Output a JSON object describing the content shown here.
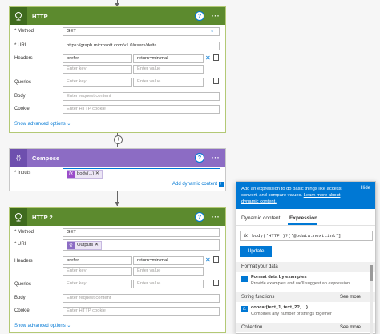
{
  "http": {
    "title": "HTTP",
    "method_label": "* Method",
    "method_value": "GET",
    "uri_label": "* URI",
    "uri_value": "https://graph.microsoft.com/v1.0/users/delta",
    "headers_label": "Headers",
    "header_key": "prefer",
    "header_value": "return=minimal",
    "enter_key": "Enter key",
    "enter_value": "Enter value",
    "queries_label": "Queries",
    "body_label": "Body",
    "body_placeholder": "Enter request content",
    "cookie_label": "Cookie",
    "cookie_placeholder": "Enter HTTP cookie",
    "advanced": "Show advanced options"
  },
  "compose": {
    "title": "Compose",
    "inputs_label": "* Inputs",
    "chip_label": "body(...)",
    "add_dynamic": "Add dynamic content"
  },
  "http2": {
    "title": "HTTP 2",
    "method_label": "* Method",
    "method_value": "GET",
    "uri_label": "* URI",
    "uri_chip": "Outputs",
    "headers_label": "Headers",
    "header_key": "prefer",
    "header_value": "return=minimal",
    "enter_key": "Enter key",
    "enter_value": "Enter value",
    "queries_label": "Queries",
    "body_label": "Body",
    "body_placeholder": "Enter request content",
    "cookie_label": "Cookie",
    "cookie_placeholder": "Enter HTTP cookie",
    "advanced": "Show advanced options"
  },
  "panel": {
    "banner_text": "Add an expression to do basic things like access, convert, and compare values.",
    "banner_link": "Learn more about dynamic content.",
    "hide": "Hide",
    "tab_dynamic": "Dynamic content",
    "tab_expression": "Expression",
    "expression": "body('HTTP')?['@odata.nextLink']",
    "update": "Update",
    "section_format": "Format your data",
    "fmt_title": "Format data by examples",
    "fmt_desc": "Provide examples and we'll suggest an expression",
    "section_string": "String functions",
    "see_more": "See more",
    "concat_title": "concat(text_1, text_2?, ...)",
    "concat_desc": "Combines any number of strings together",
    "section_collection": "Collection",
    "see_more2": "See more"
  },
  "colors": {
    "http_header": "#5c8a2e",
    "compose_header": "#8c6cc4",
    "accent": "#0078d4"
  }
}
